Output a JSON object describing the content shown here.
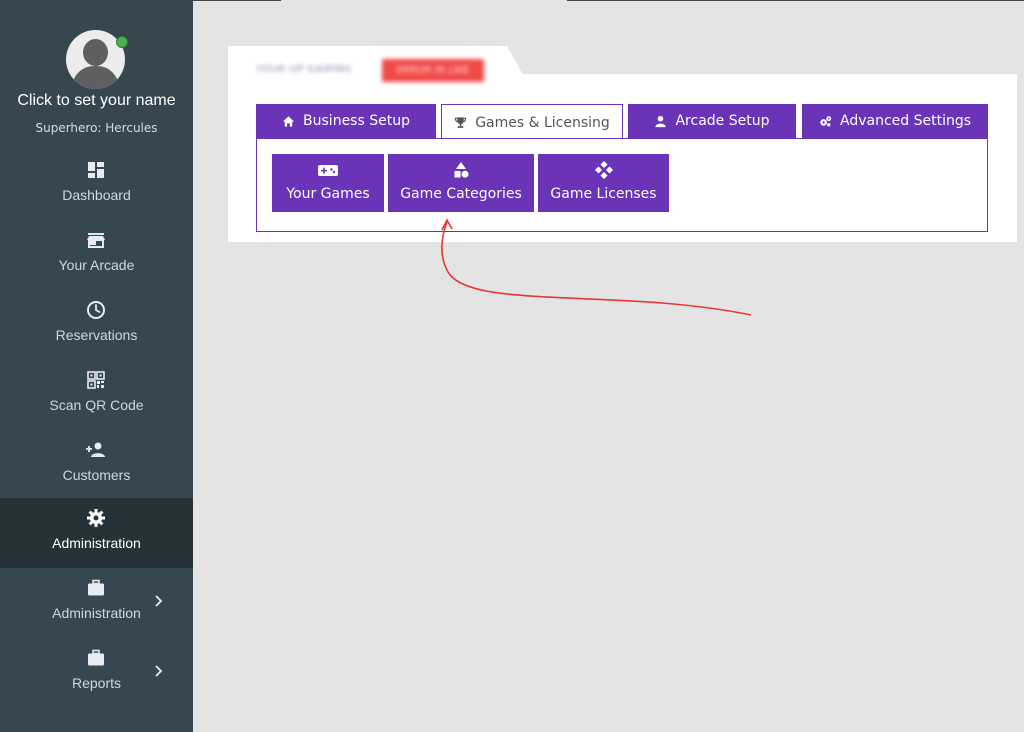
{
  "sidebar": {
    "profile": {
      "name": "Click to set your name",
      "subtitle": "Superhero: Hercules",
      "status_color": "#4caf50"
    },
    "items": [
      {
        "label": "Dashboard",
        "icon": "dashboard-icon"
      },
      {
        "label": "Your Arcade",
        "icon": "store-icon"
      },
      {
        "label": "Reservations",
        "icon": "clock-icon"
      },
      {
        "label": "Scan QR Code",
        "icon": "qr-code-icon"
      },
      {
        "label": "Customers",
        "icon": "add-person-icon"
      },
      {
        "label": "Administration",
        "icon": "gear-icon",
        "active": true
      },
      {
        "label": "Administration",
        "icon": "briefcase-icon",
        "expandable": true
      },
      {
        "label": "Reports",
        "icon": "briefcase-icon",
        "expandable": true
      }
    ]
  },
  "card": {
    "title": "YOUR UP GAMING",
    "badge": "ERROR IN LIKE"
  },
  "tabs": [
    {
      "label": "Business Setup",
      "icon": "home-icon"
    },
    {
      "label": "Games & Licensing",
      "icon": "trophy-icon",
      "active": true
    },
    {
      "label": "Arcade Setup",
      "icon": "user-icon"
    },
    {
      "label": "Advanced Settings",
      "icon": "gears-icon"
    }
  ],
  "subbuttons": [
    {
      "label": "Your Games",
      "icon": "gamepad-icon"
    },
    {
      "label": "Game Categories",
      "icon": "shapes-icon"
    },
    {
      "label": "Game Licenses",
      "icon": "dpad-icon"
    }
  ],
  "colors": {
    "sidebar_bg": "#37474f",
    "sidebar_active_bg": "#263238",
    "accent": "#6a33b8",
    "annotation": "#e53935"
  }
}
